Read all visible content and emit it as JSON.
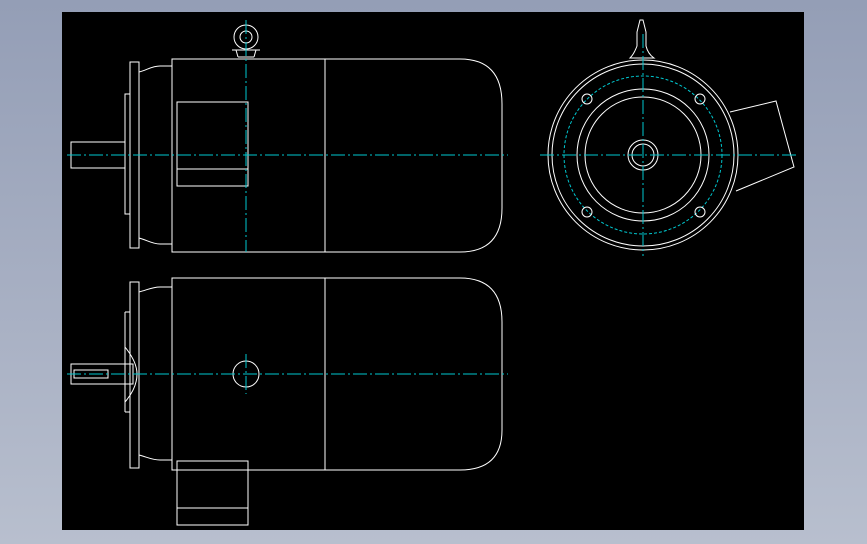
{
  "drawing": {
    "background": "#000000",
    "frame_color": "#9aa3ba",
    "line_color": "#ffffff",
    "centerline_color": "#00c8d0",
    "views": [
      {
        "id": "side-view-top",
        "description_key": "motor-side-elevation-with-terminal-box"
      },
      {
        "id": "end-view",
        "description_key": "flange-end-view"
      },
      {
        "id": "side-view-bottom",
        "description_key": "motor-plan-view-with-terminal-box"
      }
    ]
  }
}
